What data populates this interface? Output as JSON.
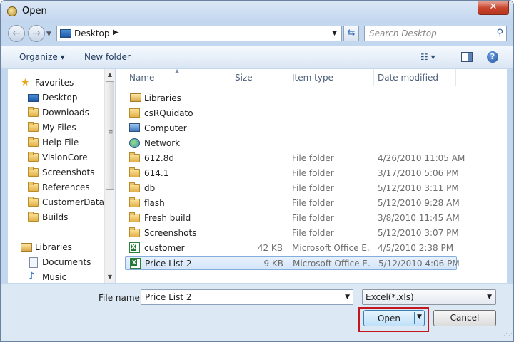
{
  "window": {
    "title": "Open",
    "close_label": "✕"
  },
  "address": {
    "location": "Desktop"
  },
  "search": {
    "placeholder": "Search Desktop"
  },
  "toolbar": {
    "organize_label": "Organize ▾",
    "new_folder_label": "New folder"
  },
  "sidebar": {
    "favorites_label": "Favorites",
    "favorites": [
      "Desktop",
      "Downloads",
      "My Files",
      "Help File",
      "VisionCore",
      "Screenshots",
      "References",
      "CustomerDatafi",
      "Builds"
    ],
    "libraries_label": "Libraries",
    "libraries": [
      "Documents",
      "Music"
    ]
  },
  "columns": {
    "name": "Name",
    "size": "Size",
    "type": "Item type",
    "date": "Date modified"
  },
  "files": [
    {
      "name": "Libraries",
      "size": "",
      "type": "",
      "date": "",
      "icon": "libraries-icon"
    },
    {
      "name": "csRQuidato",
      "size": "",
      "type": "",
      "date": "",
      "icon": "user-folder-icon"
    },
    {
      "name": "Computer",
      "size": "",
      "type": "",
      "date": "",
      "icon": "computer-icon"
    },
    {
      "name": "Network",
      "size": "",
      "type": "",
      "date": "",
      "icon": "network-icon"
    },
    {
      "name": "612.8d",
      "size": "",
      "type": "File folder",
      "date": "4/26/2010 11:05 AM",
      "icon": "folder-icon"
    },
    {
      "name": "614.1",
      "size": "",
      "type": "File folder",
      "date": "3/17/2010 5:06 PM",
      "icon": "folder-icon"
    },
    {
      "name": "db",
      "size": "",
      "type": "File folder",
      "date": "5/12/2010 3:11 PM",
      "icon": "folder-icon"
    },
    {
      "name": "flash",
      "size": "",
      "type": "File folder",
      "date": "5/12/2010 9:28 AM",
      "icon": "folder-icon"
    },
    {
      "name": "Fresh build",
      "size": "",
      "type": "File folder",
      "date": "3/8/2010 11:45 AM",
      "icon": "folder-icon"
    },
    {
      "name": "Screenshots",
      "size": "",
      "type": "File folder",
      "date": "5/12/2010 3:07 PM",
      "icon": "folder-icon"
    },
    {
      "name": "customer",
      "size": "42 KB",
      "type": "Microsoft Office E...",
      "date": "4/5/2010 2:38 PM",
      "icon": "excel-icon"
    },
    {
      "name": "Price List 2",
      "size": "9 KB",
      "type": "Microsoft Office E...",
      "date": "5/12/2010 4:06 PM",
      "icon": "excel-icon",
      "selected": true
    }
  ],
  "footer": {
    "file_name_label": "File name:",
    "file_name_value": "Price List 2",
    "file_type_value": "Excel(*.xls)",
    "open_label": "Open",
    "cancel_label": "Cancel"
  },
  "colors": {
    "highlight_border": "#c4161c",
    "selection": "#d3e5fa"
  }
}
